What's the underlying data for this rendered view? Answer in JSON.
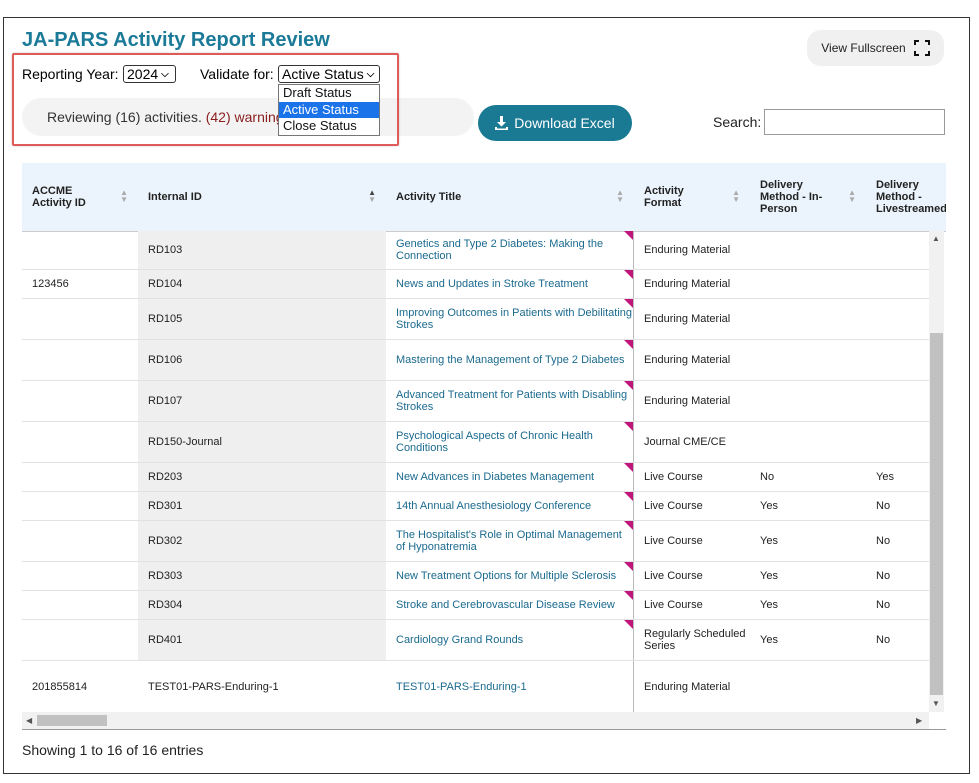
{
  "page": {
    "title": "JA-PARS Activity Report Review",
    "fullscreen_label": "View Fullscreen",
    "fullscreen_icon": "expand-icon"
  },
  "controls": {
    "year_label": "Reporting Year:",
    "year_value": "2024",
    "validate_label": "Validate for:",
    "validate_value": "Active Status",
    "validate_options": [
      "Draft Status",
      "Active Status",
      "Close Status"
    ],
    "selected_option": "Active Status"
  },
  "review": {
    "text_prefix": "Reviewing (16) activities.",
    "text_warnings": "(42) warning"
  },
  "download": {
    "label": "Download Excel",
    "icon": "download-icon"
  },
  "search": {
    "label": "Search:",
    "value": "",
    "placeholder": ""
  },
  "colors": {
    "brand": "#1b7a98",
    "button": "#1a7a93",
    "link": "#1b6a8e",
    "warning": "#8a1e1e",
    "marker": "#c0157b",
    "highlight": "#e05a5a"
  },
  "table": {
    "columns": [
      {
        "label": "ACCME Activity ID"
      },
      {
        "label": "Internal ID",
        "sorted": "asc"
      },
      {
        "label": "Activity Title"
      },
      {
        "label": "Activity Format"
      },
      {
        "label": "Delivery Method - In-Person"
      },
      {
        "label": "Delivery Method - Livestreamed"
      }
    ],
    "rows": [
      {
        "accme": "",
        "internal": "RD103",
        "title": "Genetics and Type 2 Diabetes: Making the Connection",
        "format": "Enduring Material",
        "inperson": "",
        "live": ""
      },
      {
        "accme": "123456",
        "internal": "RD104",
        "title": "News and Updates in Stroke Treatment",
        "format": "Enduring Material",
        "inperson": "",
        "live": ""
      },
      {
        "accme": "",
        "internal": "RD105",
        "title": "Improving Outcomes in Patients with Debilitating Strokes",
        "format": "Enduring Material",
        "inperson": "",
        "live": ""
      },
      {
        "accme": "",
        "internal": "RD106",
        "title": "Mastering the Management of Type 2 Diabetes",
        "format": "Enduring Material",
        "inperson": "",
        "live": ""
      },
      {
        "accme": "",
        "internal": "RD107",
        "title": "Advanced Treatment for Patients with Disabling Strokes",
        "format": "Enduring Material",
        "inperson": "",
        "live": ""
      },
      {
        "accme": "",
        "internal": "RD150-Journal",
        "title": "Psychological Aspects of Chronic Health Conditions",
        "format": "Journal CME/CE",
        "inperson": "",
        "live": ""
      },
      {
        "accme": "",
        "internal": "RD203",
        "title": "New Advances in Diabetes Management",
        "format": "Live Course",
        "inperson": "No",
        "live": "Yes"
      },
      {
        "accme": "",
        "internal": "RD301",
        "title": "14th Annual Anesthesiology Conference",
        "format": "Live Course",
        "inperson": "Yes",
        "live": "No"
      },
      {
        "accme": "",
        "internal": "RD302",
        "title": "The Hospitalist's Role in Optimal Management of Hyponatremia",
        "format": "Live Course",
        "inperson": "Yes",
        "live": "No"
      },
      {
        "accme": "",
        "internal": "RD303",
        "title": "New Treatment Options for Multiple Sclerosis",
        "format": "Live Course",
        "inperson": "Yes",
        "live": "No"
      },
      {
        "accme": "",
        "internal": "RD304",
        "title": "Stroke and Cerebrovascular Disease Review",
        "format": "Live Course",
        "inperson": "Yes",
        "live": "No"
      },
      {
        "accme": "",
        "internal": "RD401",
        "title": "Cardiology Grand Rounds",
        "format": "Regularly Scheduled Series",
        "inperson": "Yes",
        "live": "No"
      },
      {
        "accme": "201855814",
        "internal": "TEST01-PARS-Enduring-1",
        "title": "TEST01-PARS-Enduring-1",
        "format": "Enduring Material",
        "inperson": "",
        "live": ""
      }
    ]
  },
  "footer": {
    "info": "Showing 1 to 16 of 16 entries"
  }
}
